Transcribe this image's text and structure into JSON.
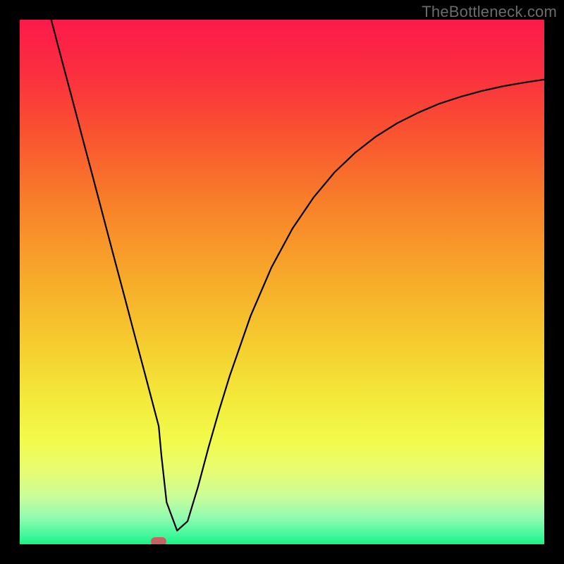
{
  "watermark": "TheBottleneck.com",
  "gradient_stops": [
    {
      "offset": 0.0,
      "color": "#fc1a4b"
    },
    {
      "offset": 0.1,
      "color": "#fb2e3f"
    },
    {
      "offset": 0.22,
      "color": "#f95430"
    },
    {
      "offset": 0.35,
      "color": "#f8802a"
    },
    {
      "offset": 0.5,
      "color": "#f7ac2a"
    },
    {
      "offset": 0.62,
      "color": "#f5cd2f"
    },
    {
      "offset": 0.72,
      "color": "#f3e93a"
    },
    {
      "offset": 0.8,
      "color": "#f2fa4b"
    },
    {
      "offset": 0.86,
      "color": "#e7fc71"
    },
    {
      "offset": 0.91,
      "color": "#c9fd9a"
    },
    {
      "offset": 0.95,
      "color": "#8ffbb0"
    },
    {
      "offset": 0.985,
      "color": "#3ef79b"
    },
    {
      "offset": 1.0,
      "color": "#18f47f"
    }
  ],
  "marker": {
    "x_frac": 0.265,
    "color": "#c86262"
  },
  "chart_data": {
    "type": "line",
    "title": "",
    "xlabel": "",
    "ylabel": "",
    "xlim": [
      0,
      100
    ],
    "ylim": [
      0,
      100
    ],
    "legend": false,
    "grid": false,
    "series": [
      {
        "name": "curve",
        "color": "#000000",
        "x": [
          6,
          8,
          10,
          12,
          14,
          16,
          18,
          20,
          22,
          24,
          25,
          26,
          26.5,
          27,
          28,
          30,
          32,
          34,
          36,
          38,
          40,
          44,
          48,
          52,
          56,
          60,
          64,
          68,
          72,
          76,
          80,
          84,
          88,
          92,
          96,
          100
        ],
        "y": [
          100,
          92.4,
          84.9,
          77.3,
          69.8,
          62.2,
          54.6,
          47.1,
          39.5,
          32.0,
          28.2,
          24.4,
          22.5,
          17.0,
          8.0,
          2.6,
          4.4,
          11.0,
          18.5,
          25.5,
          32.0,
          43.5,
          52.8,
          60.2,
          66.1,
          70.9,
          74.7,
          77.8,
          80.3,
          82.3,
          84.0,
          85.3,
          86.4,
          87.3,
          88.0,
          88.6
        ]
      }
    ],
    "annotations": [
      {
        "type": "marker",
        "shape": "rounded-rect",
        "x": 26.5,
        "y": 0,
        "color": "#c86262"
      }
    ]
  }
}
